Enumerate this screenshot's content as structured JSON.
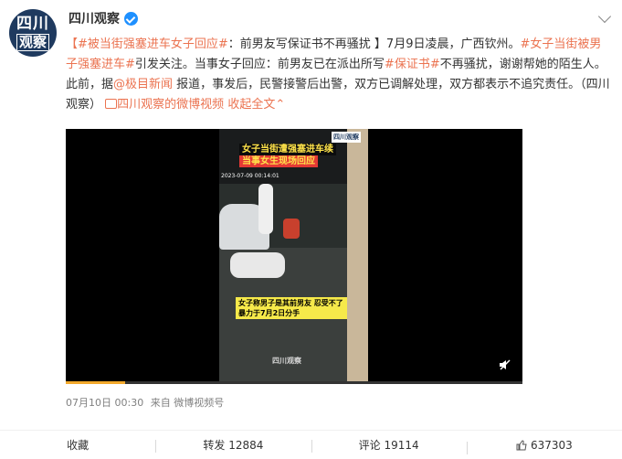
{
  "account": {
    "name": "四川观察",
    "avatar_line1": "四川",
    "avatar_line2": "观察"
  },
  "post": {
    "hashtag1": "【#被当街强塞进车女子回应#",
    "title_rest": "：前男友写保证书不再骚扰 】7月9日凌晨，广西钦州。",
    "hashtag2": "#女子当街被男子强塞进车#",
    "text2": "引发关注。当事女子回应：前男友已在派出所写",
    "hashtag3": "#保证书#",
    "text3": "不再骚扰，谢谢帮她的陌生人。此前，据",
    "mention": "@极目新闻",
    "text4": " 报道，事发后，民警接警后出警，双方已调解处理，双方都表示不追究责任。（四川观察）",
    "video_link": "四川观察的微博视频",
    "collapse": "收起全文"
  },
  "video": {
    "caption_line1": "女子当街遭强塞进车续",
    "caption_line2": "当事女生现场回应",
    "timestamp": "2023-07-09 00:14:01",
    "corner_logo": "四川观察",
    "subtitle": "女子称男子是其前男友 忍受不了暴力于7月2日分手",
    "watermark": "四川观察",
    "progress": 0.13
  },
  "meta": {
    "date": "07月10日 00:30",
    "source": "来自 微博视频号"
  },
  "actions": {
    "favorite": "收藏",
    "repost": "转发 12884",
    "comment": "评论 19114",
    "like": "637303"
  },
  "colors": {
    "link": "#eb7350",
    "verified": "#1e90ff",
    "progress": "#f2a92c"
  }
}
